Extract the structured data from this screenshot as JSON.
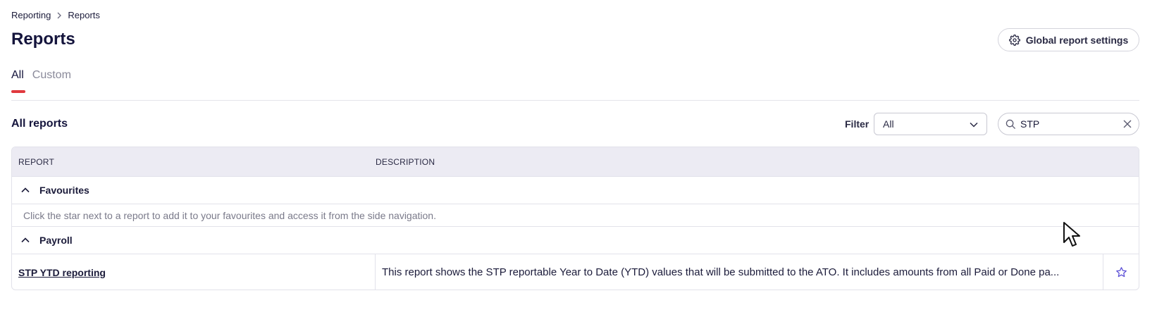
{
  "breadcrumb": {
    "parent": "Reporting",
    "current": "Reports"
  },
  "page": {
    "title": "Reports"
  },
  "header": {
    "global_settings_label": "Global report settings"
  },
  "tabs": [
    {
      "label": "All",
      "active": true
    },
    {
      "label": "Custom",
      "active": false
    }
  ],
  "section": {
    "title": "All reports"
  },
  "filter": {
    "label": "Filter",
    "selected": "All"
  },
  "search": {
    "value": "STP"
  },
  "table": {
    "headers": {
      "report": "REPORT",
      "description": "DESCRIPTION"
    },
    "groups": [
      {
        "name": "Favourites",
        "hint": "Click the star next to a report to add it to your favourites and access it from the side navigation."
      },
      {
        "name": "Payroll"
      }
    ],
    "rows": [
      {
        "report": "STP YTD reporting",
        "description": "This report shows the STP reportable Year to Date (YTD) values that will be submitted to the ATO. It includes amounts from all Paid or Done pa..."
      }
    ]
  },
  "colors": {
    "accent": "#e0393e",
    "star": "#5b4fd6",
    "title": "#14143c",
    "header_bg": "#ecebf3"
  },
  "icons": {
    "settings": "gear-icon",
    "search": "search-icon",
    "clear": "close-icon",
    "dropdown": "chevron-down-icon",
    "group_toggle": "chevron-up-icon",
    "favourite": "star-icon",
    "breadcrumb_sep": "chevron-right-icon"
  }
}
